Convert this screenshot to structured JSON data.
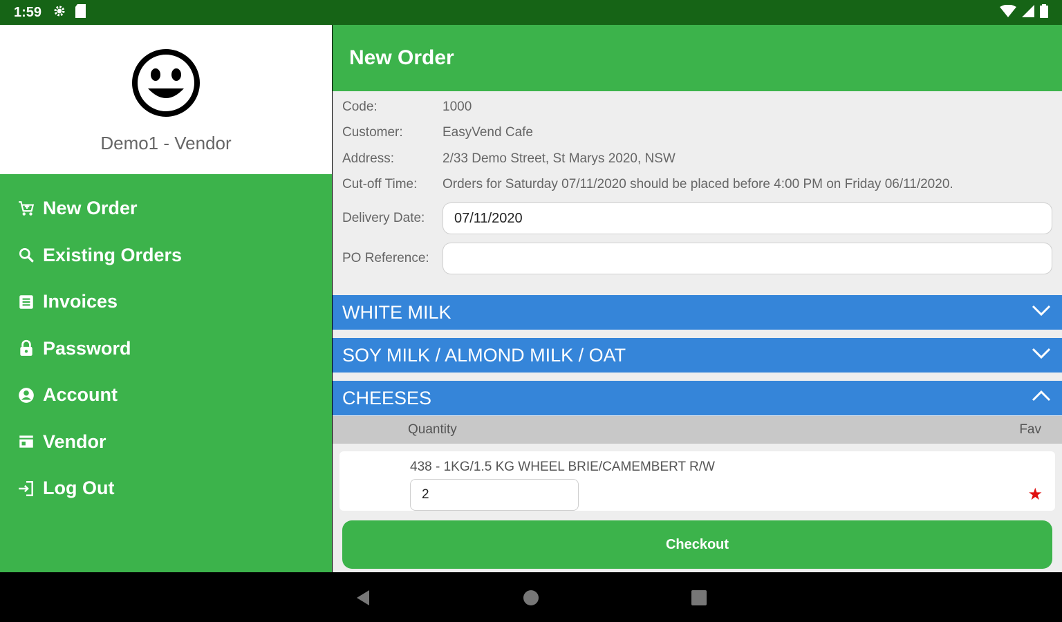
{
  "status_bar": {
    "time": "1:59"
  },
  "drawer": {
    "user_name": "Demo1 - Vendor",
    "items": [
      {
        "label": "New Order",
        "icon": "cart-icon"
      },
      {
        "label": "Existing Orders",
        "icon": "search-icon"
      },
      {
        "label": "Invoices",
        "icon": "invoice-icon"
      },
      {
        "label": "Password",
        "icon": "lock-icon"
      },
      {
        "label": "Account",
        "icon": "account-icon"
      },
      {
        "label": "Vendor",
        "icon": "store-icon"
      },
      {
        "label": "Log Out",
        "icon": "logout-icon"
      }
    ]
  },
  "app_bar": {
    "title": "New Order"
  },
  "order_info": {
    "code_label": "Code:",
    "code": "1000",
    "customer_label": "Customer:",
    "customer": "EasyVend Cafe",
    "address_label": "Address:",
    "address": "2/33 Demo Street, St Marys 2020, NSW",
    "cutoff_label": "Cut-off Time:",
    "cutoff": "Orders for Saturday 07/11/2020 should be placed before 4:00 PM on Friday 06/11/2020."
  },
  "form": {
    "delivery_label": "Delivery Date:",
    "delivery_value": "07/11/2020",
    "po_label": "PO Reference:",
    "po_value": ""
  },
  "sections": [
    {
      "title": "WHITE MILK",
      "expanded": false
    },
    {
      "title": "SOY MILK / ALMOND MILK / OAT",
      "expanded": false
    },
    {
      "title": "CHEESES",
      "expanded": true
    }
  ],
  "table": {
    "qty_header": "Quantity",
    "fav_header": "Fav"
  },
  "product": {
    "name": "438 - 1KG/1.5 KG WHEEL BRIE/CAMEMBERT R/W",
    "quantity": "2",
    "fav_symbol": "★"
  },
  "checkout_label": "Checkout",
  "colors": {
    "green": "#3cb34b",
    "dark_green": "#166416",
    "blue": "#3585d9",
    "fav": "#e01010"
  }
}
